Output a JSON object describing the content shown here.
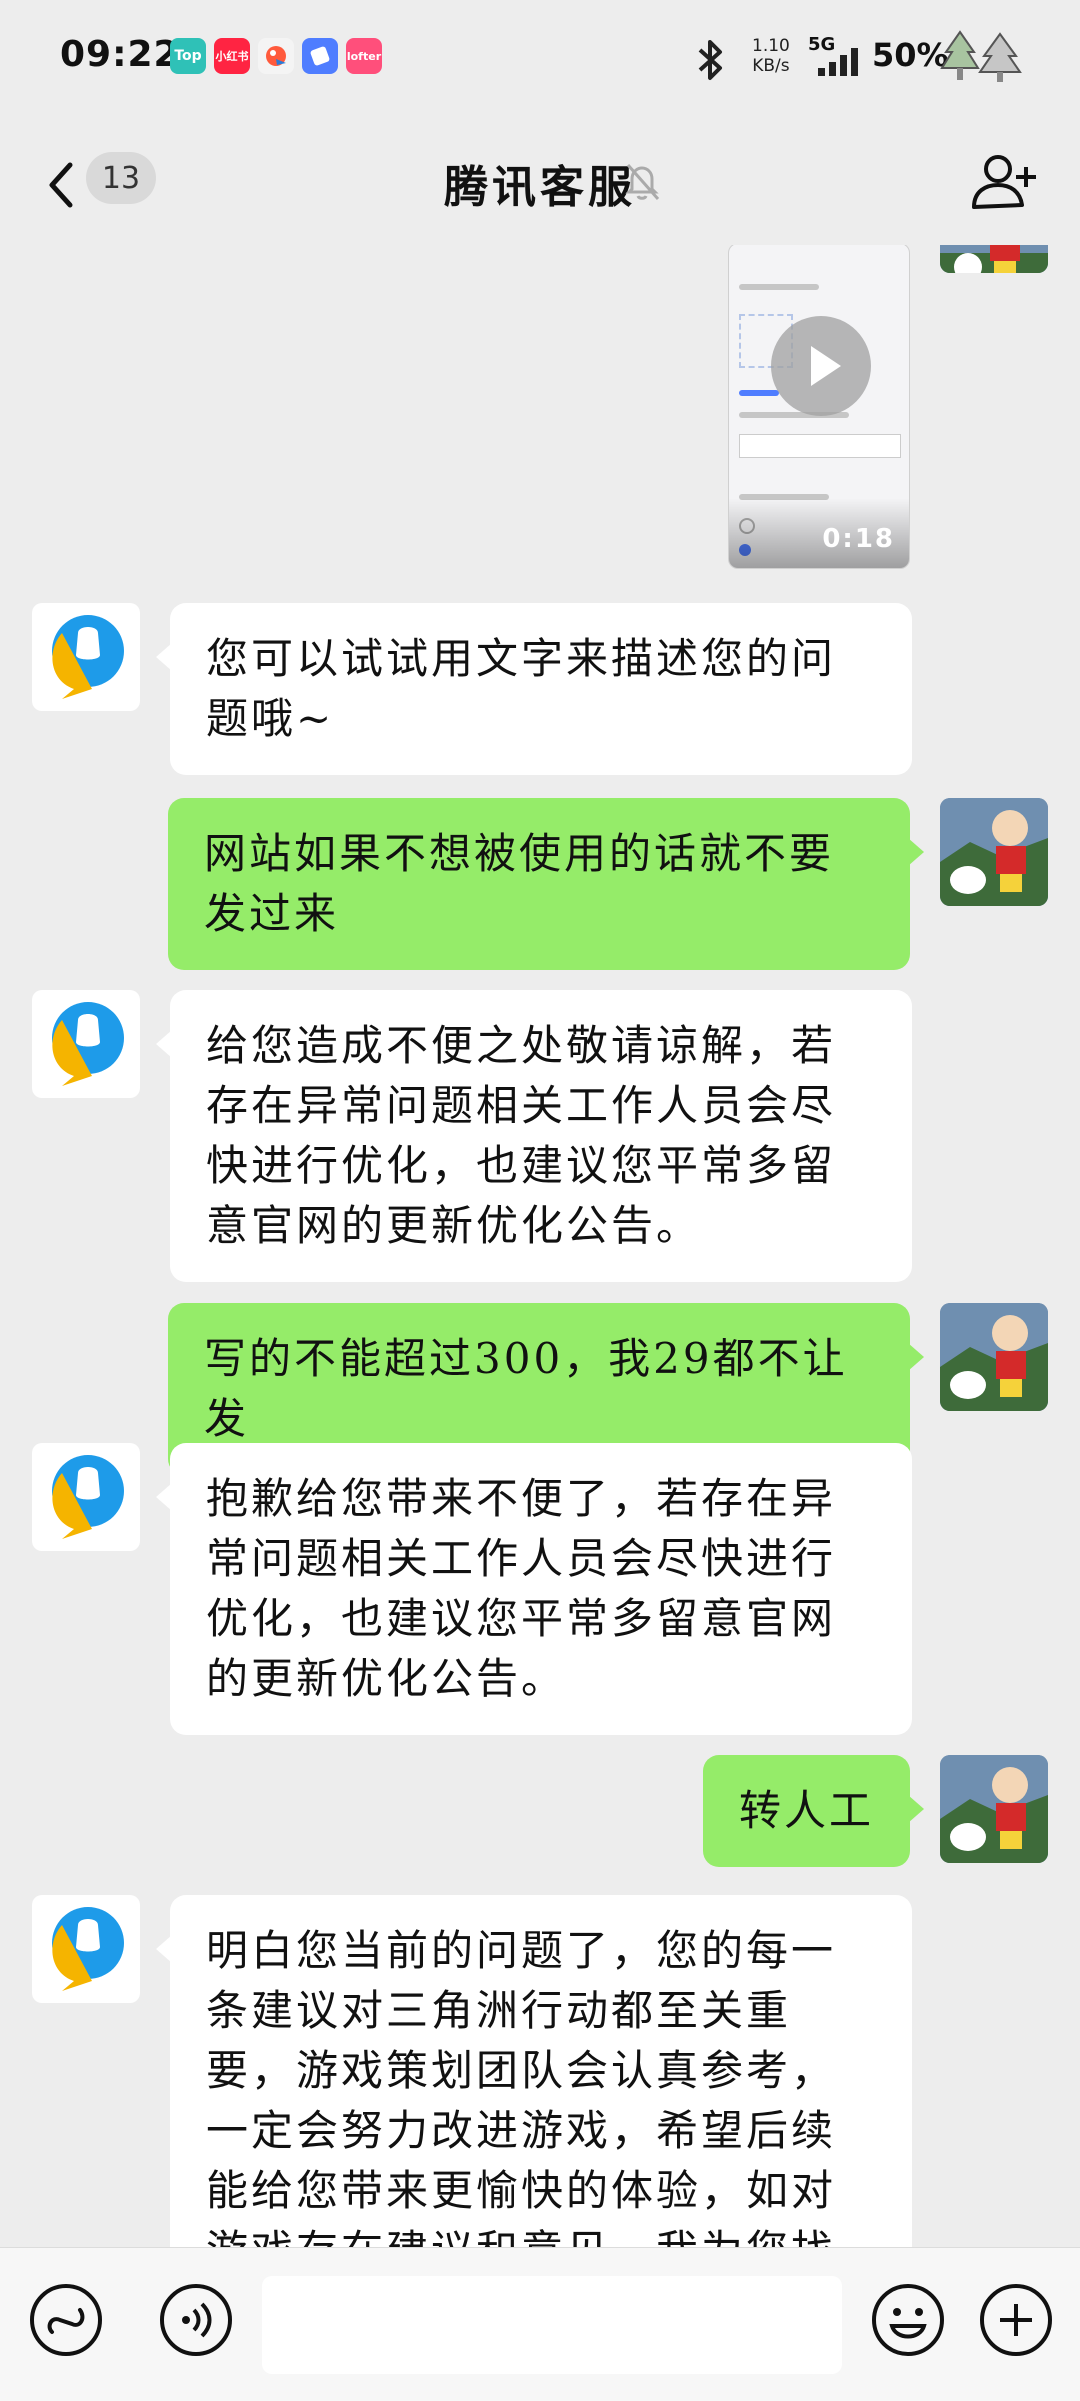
{
  "status_bar": {
    "time": "09:22",
    "app_icons": [
      {
        "label": "Top",
        "color": "#2fc1b7"
      },
      {
        "label": "小红书",
        "color": "#ff2442"
      },
      {
        "label": "",
        "color": "#f4f4f4"
      },
      {
        "label": "",
        "color": "#4f7dff"
      },
      {
        "label": "lofter",
        "color": "#ff4f7b"
      }
    ],
    "network_speed_value": "1.10",
    "network_speed_unit": "KB/s",
    "network_type": "5G",
    "battery": "50%"
  },
  "header": {
    "unread_count": "13",
    "title": "腾讯客服",
    "icons": [
      "back-icon",
      "mute-bell-icon",
      "add-friend-icon"
    ]
  },
  "video_message": {
    "duration": "0:18"
  },
  "messages": [
    {
      "side": "left",
      "text": "您可以试试用文字来描述您的问题哦~"
    },
    {
      "side": "right",
      "text": "网站如果不想被使用的话就不要发过来"
    },
    {
      "side": "left",
      "text": "给您造成不便之处敬请谅解，若存在异常问题相关工作人员会尽快进行优化，也建议您平常多留意官网的更新优化公告。"
    },
    {
      "side": "right",
      "text": "写的不能超过300，我29都不让发"
    },
    {
      "side": "left",
      "text": "抱歉给您带来不便了，若存在异常问题相关工作人员会尽快进行优化，也建议您平常多留意官网的更新优化公告。"
    },
    {
      "side": "right",
      "text": "转人工"
    },
    {
      "side": "left",
      "text": "明白您当前的问题了，您的每一条建议对三角洲行动都至关重要，游戏策划团队会认真参考，一定会努力改进游戏，希望后续能给您带来更愉快的体验，如对游戏存在建议和意见，我为您找到了以下方案"
    }
  ],
  "input_bar": {
    "placeholder": "",
    "icons": [
      "mini-program-icon",
      "voice-icon",
      "emoji-icon",
      "plus-icon"
    ]
  },
  "colors": {
    "background": "#ededed",
    "bubble_self": "#95ec69",
    "bubble_other": "#ffffff",
    "cs_avatar_blue": "#1e9be9",
    "cs_avatar_yellow": "#f5b400"
  }
}
